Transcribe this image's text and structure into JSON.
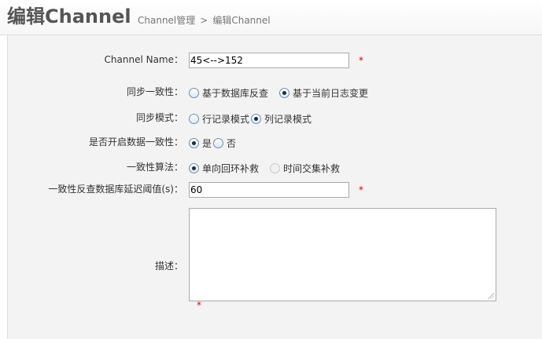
{
  "header": {
    "title": "编辑Channel",
    "breadcrumb": {
      "parent": "Channel管理",
      "separator": ">",
      "current": "编辑Channel"
    }
  },
  "form": {
    "channel_name": {
      "label": "Channel Name：",
      "value": "45<-->152",
      "required_mark": "*"
    },
    "sync_consistency": {
      "label": "同步一致性：",
      "options": [
        "基于数据库反查",
        "基于当前日志变更"
      ],
      "selected": "基于当前日志变更"
    },
    "sync_mode": {
      "label": "同步模式：",
      "options": [
        "行记录模式",
        "列记录模式"
      ],
      "selected": "列记录模式"
    },
    "enable_consistency": {
      "label": "是否开启数据一致性：",
      "options": [
        "是",
        "否"
      ],
      "selected": "是"
    },
    "consistency_algorithm": {
      "label": "一致性算法：",
      "options": [
        "单向回环补救",
        "时间交集补救"
      ],
      "selected": "单向回环补救",
      "disabled_option": "时间交集补救"
    },
    "lag_threshold": {
      "label": "一致性反查数据库延迟阈值(s)：",
      "value": "60",
      "required_mark": "*"
    },
    "description": {
      "label": "描述：",
      "value": "",
      "required_mark": "*"
    }
  }
}
